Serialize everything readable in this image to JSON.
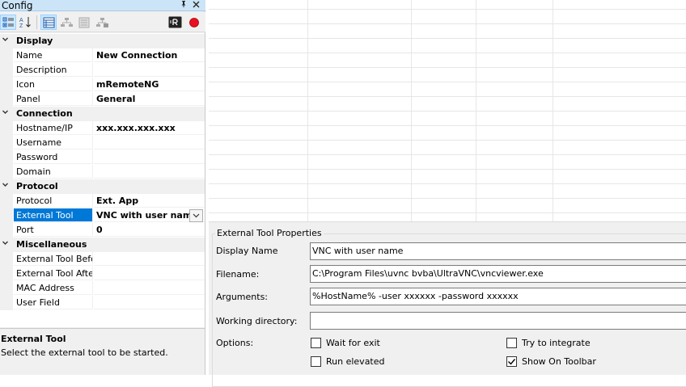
{
  "config": {
    "title": "Config",
    "pin_glyph": "📌",
    "close_glyph": "✕"
  },
  "categories": {
    "display": "Display",
    "connection": "Connection",
    "protocol": "Protocol",
    "misc": "Miscellaneous"
  },
  "properties": {
    "name": {
      "label": "Name",
      "value": "New Connection"
    },
    "description": {
      "label": "Description",
      "value": ""
    },
    "icon": {
      "label": "Icon",
      "value": "mRemoteNG"
    },
    "panel": {
      "label": "Panel",
      "value": "General"
    },
    "hostname": {
      "label": "Hostname/IP",
      "value": "xxx.xxx.xxx.xxx"
    },
    "username": {
      "label": "Username",
      "value": ""
    },
    "password": {
      "label": "Password",
      "value": ""
    },
    "domain": {
      "label": "Domain",
      "value": ""
    },
    "protocol": {
      "label": "Protocol",
      "value": "Ext. App"
    },
    "external_tool": {
      "label": "External Tool",
      "value": "VNC with user name"
    },
    "port": {
      "label": "Port",
      "value": "0"
    },
    "ext_before": {
      "label": "External Tool Before",
      "value": ""
    },
    "ext_after": {
      "label": "External Tool After",
      "value": ""
    },
    "mac": {
      "label": "MAC Address",
      "value": ""
    },
    "user_field": {
      "label": "User Field",
      "value": ""
    }
  },
  "help": {
    "title": "External Tool",
    "text": "Select the external tool to be started."
  },
  "ext_tool": {
    "group_title": "External Tool Properties",
    "display_name_label": "Display Name",
    "display_name_value": "VNC with user name",
    "filename_label": "Filename:",
    "filename_value": "C:\\Program Files\\uvnc bvba\\UltraVNC\\vncviewer.exe",
    "arguments_label": "Arguments:",
    "arguments_value": "%HostName% -user xxxxxx -password xxxxxx",
    "workdir_label": "Working directory:",
    "workdir_value": "",
    "options_label": "Options:",
    "options": {
      "wait_for_exit": {
        "label": "Wait for exit",
        "checked": false
      },
      "try_to_integrate": {
        "label": "Try to integrate",
        "checked": false
      },
      "run_elevated": {
        "label": "Run elevated",
        "checked": false
      },
      "show_on_toolbar": {
        "label": "Show On Toolbar",
        "checked": true
      }
    }
  },
  "colors": {
    "selection": "#0078d7",
    "titlebar": "#cce4f7",
    "record": "#e81123"
  }
}
